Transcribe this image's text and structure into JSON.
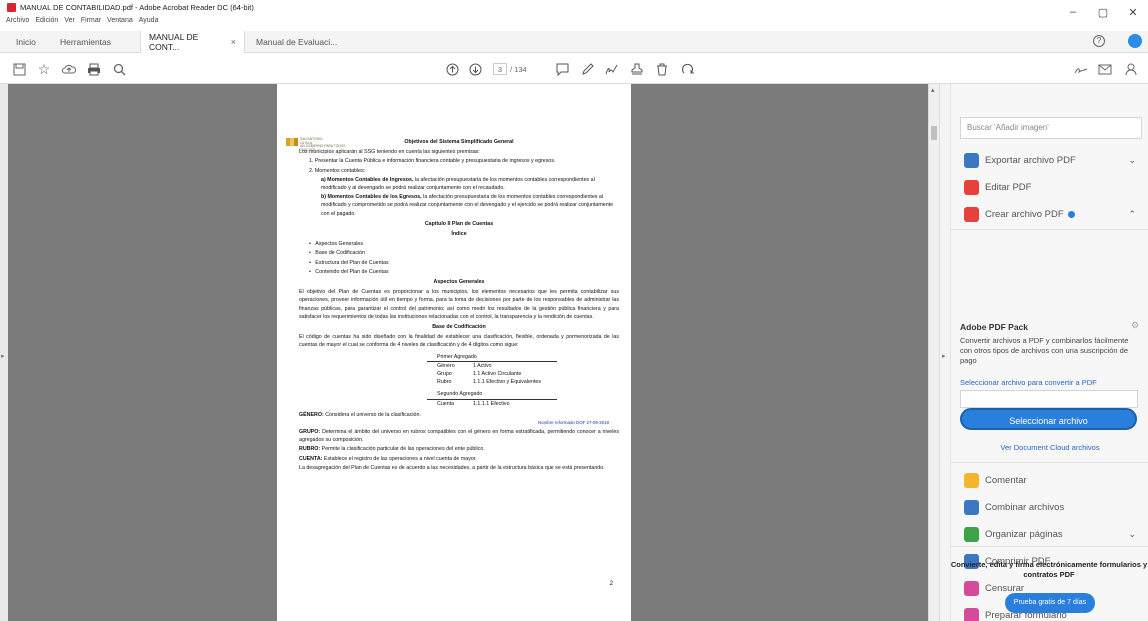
{
  "window": {
    "title": "MANUAL DE CONTABILIDAD.pdf - Adobe Acrobat Reader DC (64-bit)",
    "minimize": "–",
    "maximize": "▢",
    "close": "✕"
  },
  "menu": [
    "Archivo",
    "Edición",
    "Ver",
    "Firmar",
    "Ventana",
    "Ayuda"
  ],
  "tabs": [
    {
      "label": "Inicio"
    },
    {
      "label": "Herramientas"
    },
    {
      "label": "MANUAL DE CONT...",
      "close": "×"
    },
    {
      "label": "Manual de Evaluaci..."
    }
  ],
  "toolbar": {
    "page_current": "3",
    "page_total": "/ 134"
  },
  "document": {
    "logo_text": [
      "SAN ANTONIO",
      "LA ISLA",
      "UN GOBIERNO PARA TODOS",
      "2019-2021"
    ],
    "title": "Objetivos del Sistema Simplificado General",
    "intro": "Los municipios aplicarán al SSG teniendo en cuenta las siguientes premisas:",
    "item1": "1.    Presentar la Cuenta Pública e información financiera contable y presupuestaria de ingresos y egresos.",
    "item2": "2.    Momentos contables:",
    "sub_a_head": "a)   Momentos Contables de Ingresos,",
    "sub_a_text": " la afectación presupuestaria de los momentos contables correspondientes al modificado y al devengado se podrá realizar conjuntamente con el recaudado.",
    "sub_b_head": "b)   Momentos Contables de los Egresos,",
    "sub_b_text": " la afectación presupuestaria de los momentos contables correspondientes al modificado y comprometido se podrá realizar conjuntamente con el devengado y el ejercido se podrá realizar conjuntamente con el pagado.",
    "chapter": "Capítulo II Plan de Cuentas",
    "index": "Índice",
    "bullets": [
      "Aspectos Generales",
      "Base de Codificación",
      "Estructura del Plan de Cuentas",
      "Contenido del Plan de Cuentas"
    ],
    "aspectos_title": "Aspectos Generales",
    "aspectos_text": "El objetivo del Plan de Cuentas es proporcionar a los municipios, los elementos necesarios que les permita contabilizar sus operaciones, proveer información útil en tiempo y forma, para la toma de decisiones por parte de los responsables de administrar las finanzas públicas, para garantizar el control del patrimonio; así como medir los resultados de la gestión pública financiera y para satisfacer los requerimientos de todas las instituciones relacionadas con el control, la transparencia y la rendición de cuentas.",
    "base_title": "Base de Codificación",
    "base_text": "El código de cuentas ha sido diseñado con la finalidad de establecer una clasificación, flexible, ordenada y pormenorizada de las cuentas de mayor el cual se conforma de 4 niveles de clasificación y de 4 dígitos como sigue:",
    "table1_title": "Primer Agregado",
    "table1": [
      [
        "Género",
        "1 Activo"
      ],
      [
        "Grupo",
        "1.1 Activo Circulante"
      ],
      [
        "Rubro",
        "1.1.1 Efectivo y Equivalentes"
      ]
    ],
    "table2_title": "Segundo Agregado",
    "table2": [
      [
        "Cuenta",
        "1.1.1.1 Efectivo"
      ]
    ],
    "genero_head": "GÉNERO:",
    "genero_text": " Considera el universo de la clasificación.",
    "note": "Nombre reformado DOF 27-09-2018",
    "grupo_head": "GRUPO:",
    "grupo_text": " Determina el ámbito del universo en rubros compatibles con el género en forma estratificada, permitiendo conocer a niveles agregados su composición.",
    "rubro_head": "RUBRO:",
    "rubro_text": " Permite la clasificación particular de las operaciones del ente público.",
    "cuenta_head": "CUENTA:",
    "cuenta_text": " Establece el registro de las operaciones a nivel cuenta de mayor.",
    "final_text": "La desagregación del Plan de Cuentas es de acuerdo a las necesidades, a partir de la estructura básica que se está presentando.",
    "page_number": "2"
  },
  "right_panel": {
    "search_placeholder": "Buscar 'Añadir imagen'",
    "tools_top": [
      {
        "label": "Exportar archivo PDF",
        "icon": "export-pdf-icon",
        "color": "#3b78c2"
      },
      {
        "label": "Editar PDF",
        "icon": "edit-pdf-icon",
        "color": "#e8413c"
      },
      {
        "label": "Crear archivo PDF",
        "icon": "create-pdf-icon",
        "color": "#e8413c"
      }
    ],
    "pack_title": "Adobe PDF Pack",
    "pack_desc": "Convertir archivos a PDF y combinarlos fácilmente con otros tipos de archivos con una suscripción de pago",
    "pack_link": "Seleccionar archivo para convertir a PDF",
    "select_button": "Seleccionar archivo",
    "doc_cloud": "Ver Document Cloud archivos",
    "tools_bottom": [
      {
        "label": "Comentar",
        "icon": "comment-icon",
        "color": "#f2b52c"
      },
      {
        "label": "Combinar archivos",
        "icon": "combine-icon",
        "color": "#3b78c2"
      },
      {
        "label": "Organizar páginas",
        "icon": "organize-icon",
        "color": "#3ca34a"
      },
      {
        "label": "Comprimir PDF",
        "icon": "compress-icon",
        "color": "#3b78c2"
      },
      {
        "label": "Censurar",
        "icon": "redact-icon",
        "color": "#d64a9b"
      },
      {
        "label": "Preparar formulario",
        "icon": "form-icon",
        "color": "#d64a9b"
      }
    ],
    "promo": "Convierte, edita y firma electrónicamente formularios y contratos PDF",
    "trial_button": "Prueba gratis de 7 días"
  }
}
